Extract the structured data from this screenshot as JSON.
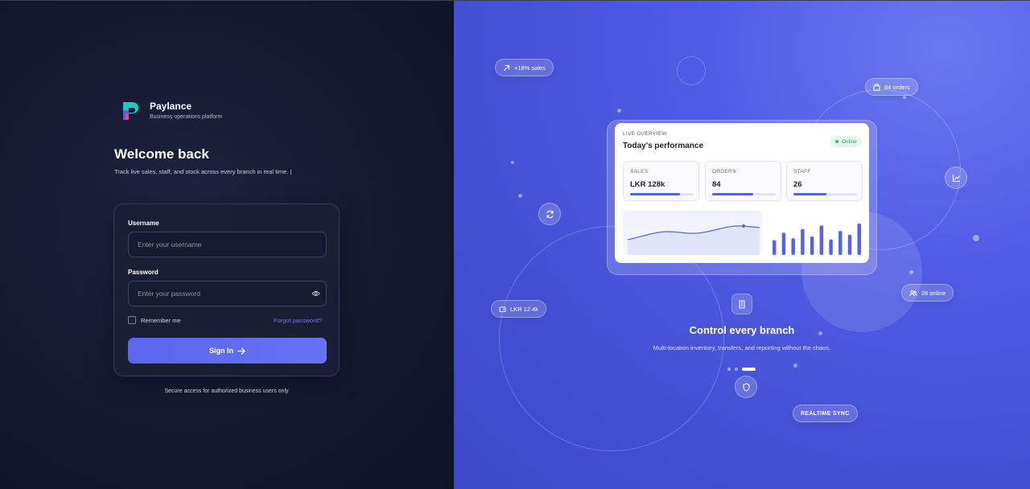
{
  "brand": {
    "name": "Paylance",
    "tagline": "Business operations platform",
    "logo_icon": "paylance-logo-icon"
  },
  "login": {
    "title": "Welcome back",
    "subtitle": "Track live sales, staff, and stock across every branch in real time. |",
    "username_label": "Username",
    "username_placeholder": "Enter your username",
    "password_label": "Password",
    "password_placeholder": "Enter your password",
    "remember_label": "Remember me",
    "forgot_label": "Forgot password?",
    "signin_label": "Sign In",
    "secure_note": "Secure access for authorized business users only"
  },
  "floating": {
    "sales_pill": "+18% sales",
    "orders_pill": "84 orders",
    "wallet_pill": "LKR 12.4k",
    "online_pill": "26 online",
    "realtime_pill": "REALTIME SYNC"
  },
  "overview": {
    "kicker": "LIVE OVERVIEW",
    "title": "Today's performance",
    "status": "Online",
    "stats": [
      {
        "label": "SALES",
        "value": "LKR 128k",
        "progress": 0.78
      },
      {
        "label": "ORDERS",
        "value": "84",
        "progress": 0.64
      },
      {
        "label": "STAFF",
        "value": "26",
        "progress": 0.52
      }
    ],
    "bar_levels": [
      0.4,
      0.6,
      0.45,
      0.7,
      0.5,
      0.8,
      0.42,
      0.65,
      0.55,
      0.85
    ]
  },
  "hero": {
    "title": "Control every branch",
    "subtitle": "Multi-location inventory, transfers, and reporting without the chaos."
  },
  "colors": {
    "accent": "#5a66ee",
    "left_bg": "#151a31",
    "right_bg": "#4f5be4",
    "online_green": "#2fbf6a"
  }
}
